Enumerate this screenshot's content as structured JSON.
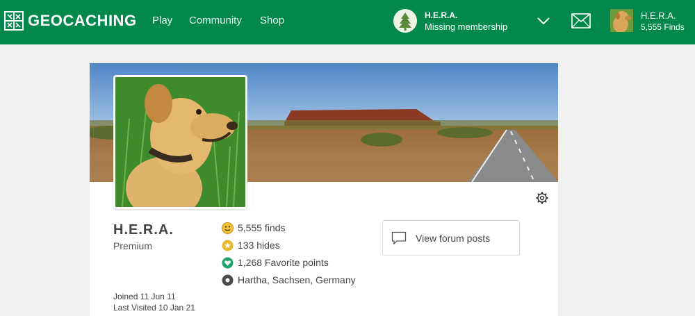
{
  "header": {
    "logo_text": "GEOCACHING",
    "nav": [
      "Play",
      "Community",
      "Shop"
    ],
    "member": {
      "name": "H.E.R.A.",
      "status": "Missing membership"
    },
    "user": {
      "name": "H.E.R.A.",
      "finds": "5,555 Finds"
    }
  },
  "profile": {
    "username": "H.E.R.A.",
    "membership": "Premium",
    "joined": "Joined 11 Jun 11",
    "last_visited": "Last Visited 10 Jan 21",
    "stats": {
      "finds": "5,555 finds",
      "hides": "133 hides",
      "favorites": "1,268 Favorite points",
      "location": "Hartha, Sachsen, Germany"
    },
    "forum_button": "View forum posts"
  },
  "icons": {
    "finds": "smiley-face-icon",
    "hides": "star-icon",
    "favorites": "heart-icon",
    "location": "location-pin-icon",
    "forum": "speech-bubble-icon",
    "settings": "gear-icon"
  },
  "colors": {
    "brand_green": "#02874d",
    "finds_yellow": "#f2c335",
    "hides_gold": "#e8b731",
    "favorite_green": "#20a36a",
    "location_dark": "#4a4a4a"
  }
}
